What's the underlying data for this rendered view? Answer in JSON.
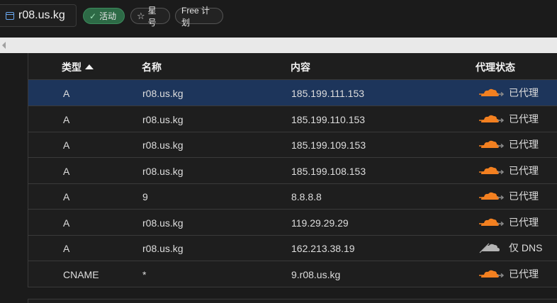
{
  "header": {
    "domain": "r08.us.kg",
    "status_badge": "活动",
    "star_label": "星号",
    "plan_label": "Free 计划"
  },
  "table": {
    "columns": {
      "type": "类型",
      "name": "名称",
      "content": "内容",
      "proxy": "代理状态"
    },
    "rows": [
      {
        "type": "A",
        "name": "r08.us.kg",
        "content": "185.199.111.153",
        "proxy": "已代理",
        "proxied": true
      },
      {
        "type": "A",
        "name": "r08.us.kg",
        "content": "185.199.110.153",
        "proxy": "已代理",
        "proxied": true
      },
      {
        "type": "A",
        "name": "r08.us.kg",
        "content": "185.199.109.153",
        "proxy": "已代理",
        "proxied": true
      },
      {
        "type": "A",
        "name": "r08.us.kg",
        "content": "185.199.108.153",
        "proxy": "已代理",
        "proxied": true
      },
      {
        "type": "A",
        "name": "9",
        "content": "8.8.8.8",
        "proxy": "已代理",
        "proxied": true
      },
      {
        "type": "A",
        "name": "r08.us.kg",
        "content": "119.29.29.29",
        "proxy": "已代理",
        "proxied": true
      },
      {
        "type": "A",
        "name": "r08.us.kg",
        "content": "162.213.38.19",
        "proxy": "仅 DNS",
        "proxied": false
      },
      {
        "type": "CNAME",
        "name": "*",
        "content": "9.r08.us.kg",
        "proxy": "已代理",
        "proxied": true
      }
    ]
  },
  "icons": {
    "proxied": "orange-cloud-icon",
    "dns_only": "grey-cloud-icon"
  },
  "colors": {
    "proxied_cloud": "#f38020",
    "dns_only_cloud": "#b5b5b5",
    "selected_row": "#1d355b",
    "active_badge": "#2d6a46"
  }
}
